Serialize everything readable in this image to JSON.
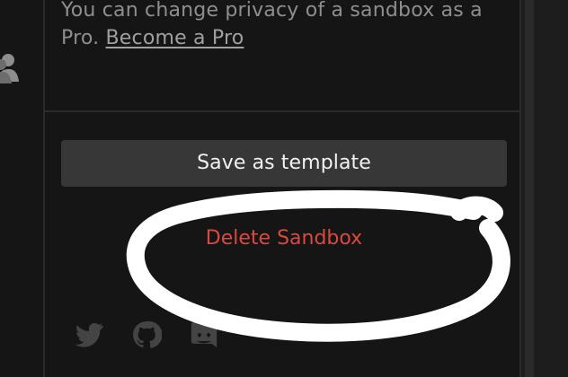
{
  "privacy": {
    "message": "You can change privacy of a sandbox as a Pro.",
    "link_text": "Become a Pro"
  },
  "actions": {
    "save_template_label": "Save as template",
    "delete_sandbox_label": "Delete Sandbox"
  },
  "icons": {
    "left_rail": "user-group-icon",
    "social": [
      "twitter-icon",
      "github-icon",
      "discord-icon"
    ]
  },
  "colors": {
    "background": "#151515",
    "button": "#373737",
    "danger": "#d9493f",
    "annotation": "#ffffff"
  }
}
